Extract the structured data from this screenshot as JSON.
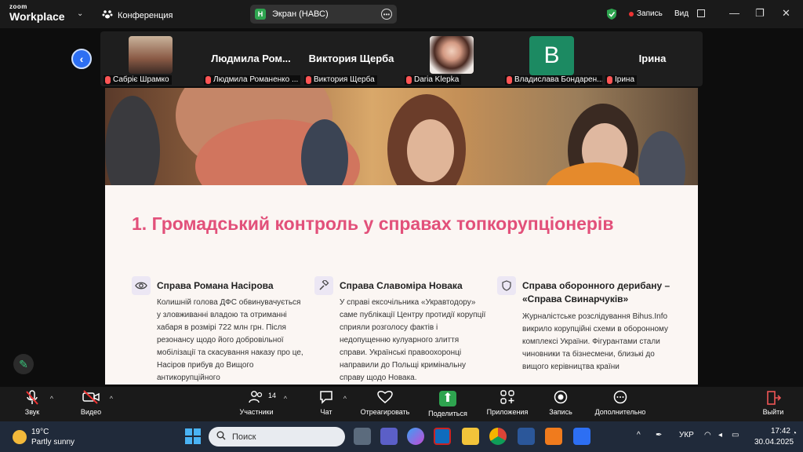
{
  "topbar": {
    "brand_small": "zoom",
    "brand_big": "Workplace",
    "conference_label": "Конференция",
    "screen_badge": "H",
    "screen_label": "Экран (НАВС)",
    "record_label": "Запись",
    "view_label": "Вид"
  },
  "participants": [
    {
      "display": "",
      "label": "Сабріє Шрамко",
      "kind": "photo"
    },
    {
      "display": "Людмила Ром...",
      "label": "Людмила Романенко ...",
      "kind": "name"
    },
    {
      "display": "Виктория Щерба",
      "label": "Виктория Щерба",
      "kind": "name"
    },
    {
      "display": "",
      "label": "Daria Klepka",
      "kind": "photo"
    },
    {
      "display": "B",
      "label": "Владислава Бондарен...",
      "kind": "avatar"
    },
    {
      "display": "Ірина",
      "label": "Ірина",
      "kind": "name"
    }
  ],
  "slide": {
    "title": "1. Громадський контроль у справах топкорупціонерів",
    "columns": [
      {
        "icon": "eye-icon",
        "heading": "Справа Романа Насірова",
        "body": "Колишній голова ДФС обвинувачується у зловживанні владою та отриманні хабаря в розмірі 722 млн грн. Після резонансу щодо його добровільної мобілізації та скасування наказу про це, Насіров прибув до Вищого антикорупційного"
      },
      {
        "icon": "gavel-icon",
        "heading": "Справа Славоміра Новака",
        "body": "У справі ексочільника «Укравтодору» саме публікації Центру протидії корупції сприяли розголосу фактів і недопущенню кулуарного злиття справи. Українські правоохоронці направили до Польщі кримінальну справу щодо Новака."
      },
      {
        "icon": "shield-icon",
        "heading": "Справа оборонного дерибану – «Справа Свинарчуків»",
        "body": "Журналістське розслідування Bihus.Info викрило корупційні схеми в оборонному комплексі України. Фігурантами стали чиновники та бізнесмени, близькі до вищого керівництва країни"
      }
    ]
  },
  "toolbar": {
    "audio": "Звук",
    "video": "Видео",
    "participants": "Участники",
    "participants_count": "14",
    "chat": "Чат",
    "react": "Отреагировать",
    "share": "Поделиться",
    "apps": "Приложения",
    "record": "Запись",
    "more": "Дополнительно",
    "leave": "Выйти"
  },
  "taskbar": {
    "temp": "19°C",
    "weather": "Partly sunny",
    "search_placeholder": "Поиск",
    "lang": "УКР",
    "time": "17:42",
    "date": "30.04.2025"
  }
}
